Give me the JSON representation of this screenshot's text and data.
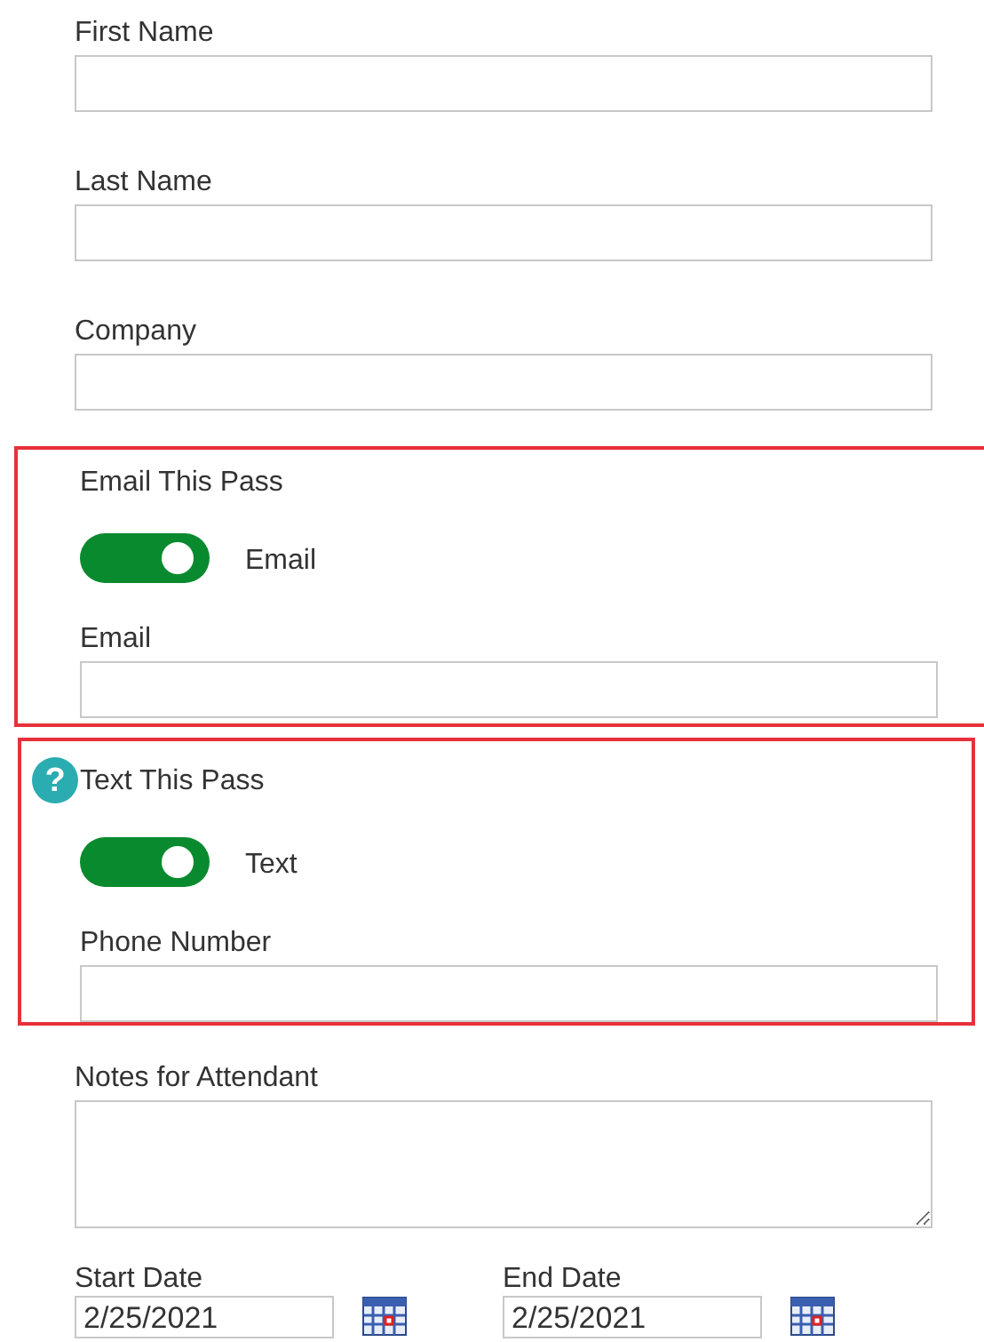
{
  "items": [
    {
      "kind": "text",
      "label": "First Name"
    },
    {
      "kind": "text",
      "label": "Last Name"
    },
    {
      "kind": "text",
      "label": "Company"
    },
    {
      "kind": "section",
      "title": "Email This Pass",
      "toggle": {
        "on": true,
        "label": "Email"
      },
      "field": {
        "label": "Email"
      }
    },
    {
      "kind": "section",
      "help_icon": "?",
      "title": "Text This Pass",
      "toggle": {
        "on": true,
        "label": "Text"
      },
      "field": {
        "label": "Phone Number"
      }
    },
    {
      "kind": "textarea",
      "label": "Notes for Attendant"
    },
    {
      "kind": "dates",
      "dates": [
        {
          "label": "Start Date",
          "value": "2/25/2021"
        },
        {
          "label": "End Date",
          "value": "2/25/2021"
        }
      ]
    }
  ]
}
